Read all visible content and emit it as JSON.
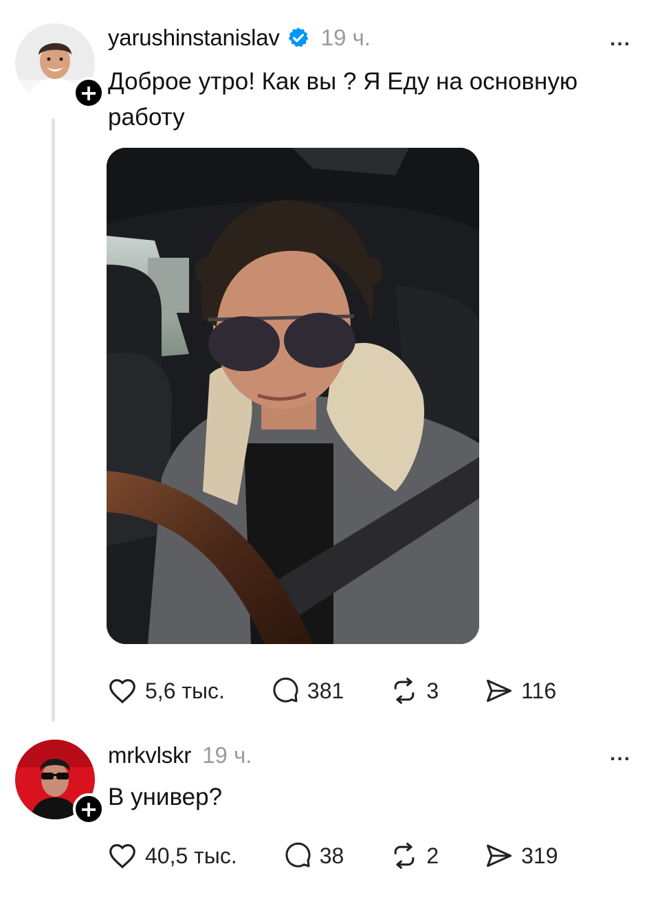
{
  "posts": [
    {
      "username": "yarushinstanislav",
      "verified": true,
      "time": "19 ч.",
      "more": "...",
      "text": "Доброе утро! Как вы ? Я Еду на основную работу",
      "follow_symbol": "+",
      "likes": "5,6 тыс.",
      "replies": "381",
      "reposts": "3",
      "shares": "116"
    },
    {
      "username": "mrkvlskr",
      "verified": false,
      "time": "19 ч.",
      "more": "...",
      "text": "В универ?",
      "follow_symbol": "+",
      "likes": "40,5 тыс.",
      "replies": "38",
      "reposts": "2",
      "shares": "319"
    }
  ],
  "icons": {
    "like": "heart-icon",
    "reply": "comment-icon",
    "repost": "repost-icon",
    "share": "send-icon",
    "verified": "verified-badge-icon",
    "more": "more-dots-icon"
  },
  "colors": {
    "verified_blue": "#0095f6",
    "text": "#111111",
    "muted": "#9a9a9a",
    "thread_line": "#e3e3e3",
    "avatar2_bg": "#d8121f"
  }
}
